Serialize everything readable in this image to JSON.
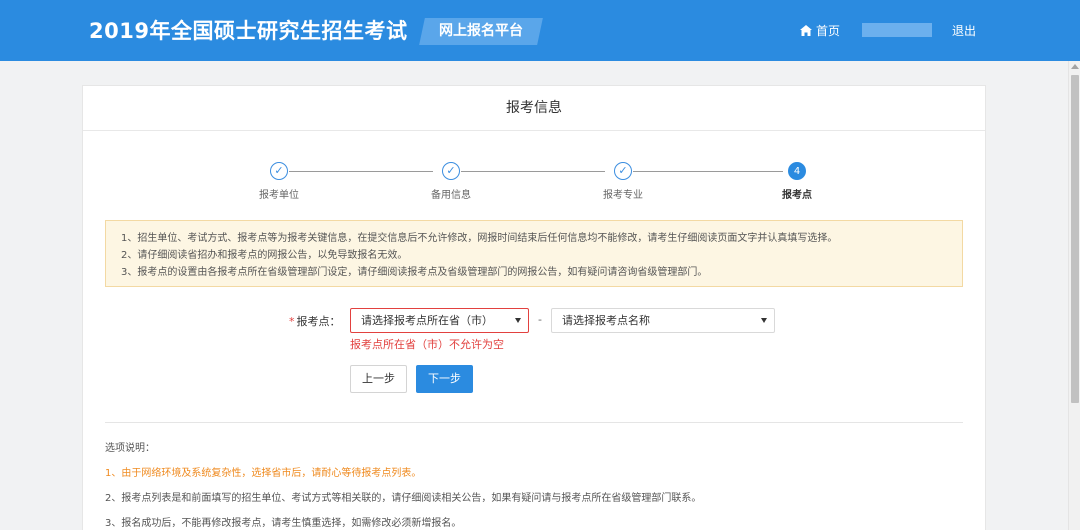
{
  "header": {
    "brand": "2019年全国硕士研究生招生考试",
    "platform": "网上报名平台",
    "home_label": "首页",
    "logout_label": "退出",
    "home_icon": "home-icon"
  },
  "card": {
    "title": "报考信息"
  },
  "steps": [
    {
      "label": "报考单位",
      "state": "done",
      "symbol": "✓"
    },
    {
      "label": "备用信息",
      "state": "done",
      "symbol": "✓"
    },
    {
      "label": "报考专业",
      "state": "done",
      "symbol": "✓"
    },
    {
      "label": "报考点",
      "state": "active",
      "symbol": "4"
    }
  ],
  "notice": [
    "1、招生单位、考试方式、报考点等为报考关键信息，在提交信息后不允许修改，网报时间结束后任何信息均不能修改，请考生仔细阅读页面文字并认真填写选择。",
    "2、请仔细阅读省招办和报考点的网报公告，以免导致报名无效。",
    "3、报考点的设置由各报考点所在省级管理部门设定，请仔细阅读报考点及省级管理部门的网报公告，如有疑问请咨询省级管理部门。"
  ],
  "form": {
    "required_mark": "*",
    "label": "报考点：",
    "province_select": "请选择报考点所在省（市）",
    "separator": "-",
    "site_select": "请选择报考点名称",
    "error": "报考点所在省（市）不允许为空"
  },
  "buttons": {
    "prev": "上一步",
    "next": "下一步"
  },
  "explain": {
    "title": "选项说明：",
    "items": [
      "1、由于网络环境及系统复杂性，选择省市后，请耐心等待报考点列表。",
      "2、报考点列表是和前面填写的招生单位、考试方式等相关联的，请仔细阅读相关公告，如果有疑问请与报考点所在省级管理部门联系。",
      "3、报名成功后，不能再修改报考点，请考生慎重选择，如需修改必须新增报名。"
    ]
  },
  "colors": {
    "primary": "#2b8be0",
    "error": "#e2413f",
    "warning_text": "#ef8a1f",
    "notice_bg": "#fdf6e3"
  }
}
